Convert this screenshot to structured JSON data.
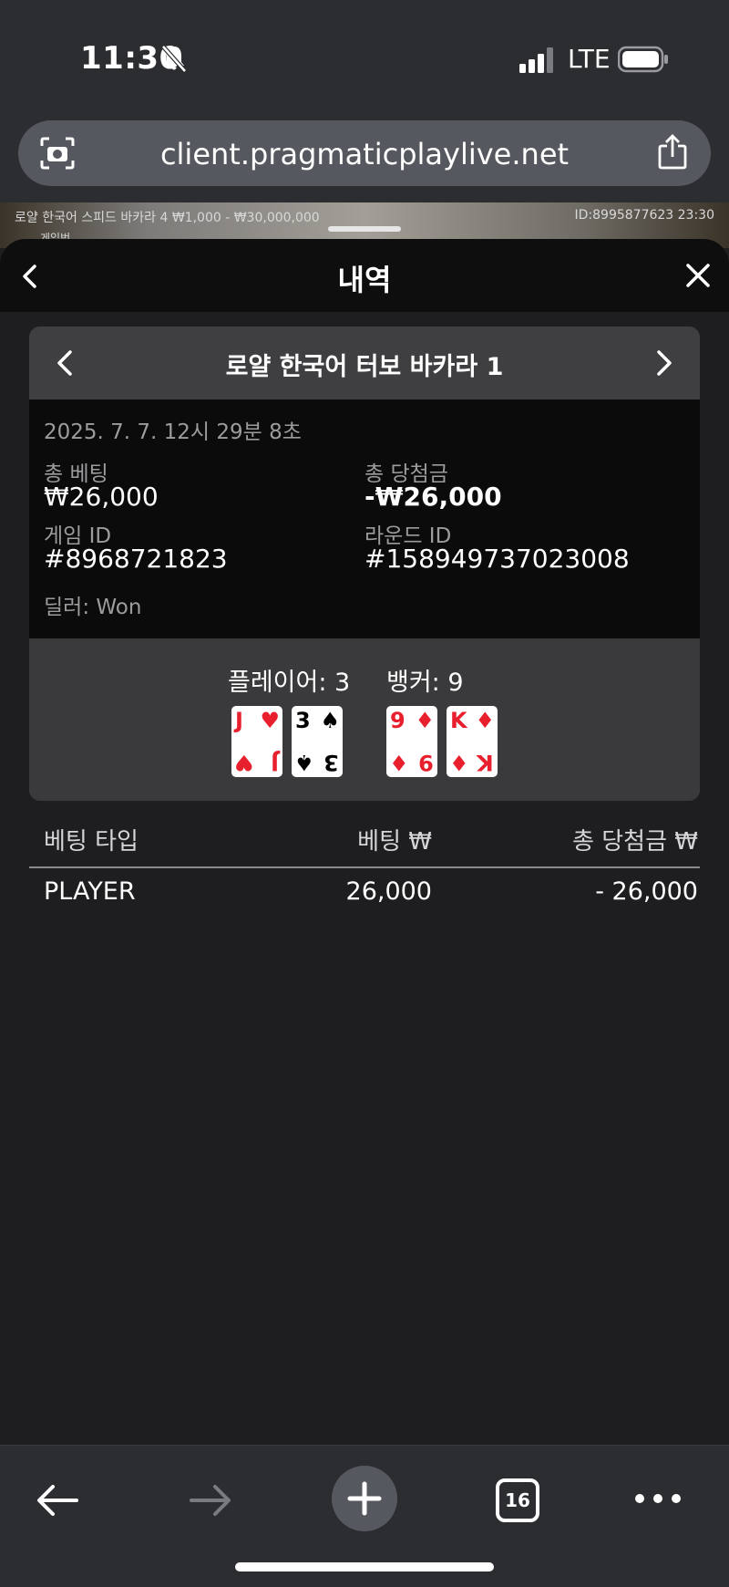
{
  "status_bar": {
    "time": "11:30",
    "network": "LTE"
  },
  "browser": {
    "url": "client.pragmaticplaylive.net",
    "tab_count": "16"
  },
  "background_game": {
    "table_info": "로얄 한국어 스피드 바카라 4  ₩1,000 - ₩30,000,000",
    "id_time": "ID:8995877623  23:30",
    "sub_text": "게임번"
  },
  "sheet": {
    "title": "내역"
  },
  "game_card": {
    "title": "로얄 한국어 터보 바카라 1",
    "datetime": "2025. 7. 7. 12시 29분 8초",
    "total_bet_label": "총 베팅",
    "total_bet_value": "₩26,000",
    "total_win_label": "총 당첨금",
    "total_win_value": "-₩26,000",
    "game_id_label": "게임 ID",
    "game_id_value": "#8968721823",
    "round_id_label": "라운드 ID",
    "round_id_value": "#158949737023008",
    "dealer": "딜러: Won",
    "player_score": "플레이어: 3",
    "banker_score": "뱅커: 9",
    "player_cards": [
      {
        "rank": "J",
        "suit": "♥",
        "color": "#e8202e"
      },
      {
        "rank": "3",
        "suit": "♠",
        "color": "#000000"
      }
    ],
    "banker_cards": [
      {
        "rank": "9",
        "suit": "♦",
        "color": "#e8202e"
      },
      {
        "rank": "K",
        "suit": "♦",
        "color": "#e8202e"
      }
    ]
  },
  "bets_table": {
    "headers": [
      "베팅 타입",
      "베팅 ₩",
      "총 당첨금 ₩"
    ],
    "rows": [
      {
        "type": "PLAYER",
        "bet": "26,000",
        "win": "- 26,000"
      }
    ]
  }
}
